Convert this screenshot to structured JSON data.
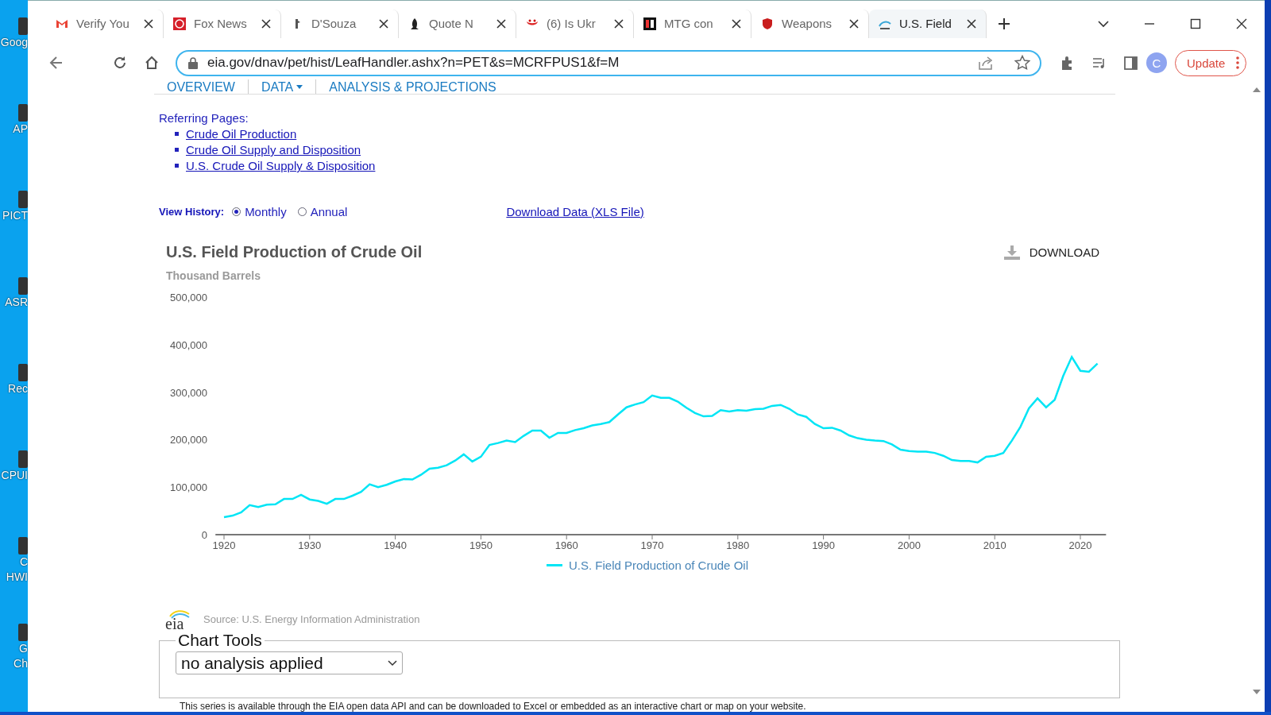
{
  "desktop_icons": [
    {
      "lines": [
        "Goog"
      ]
    },
    {
      "lines": [
        "AP"
      ]
    },
    {
      "lines": [
        "PICT"
      ]
    },
    {
      "lines": [
        "ASR"
      ]
    },
    {
      "lines": [
        "Rec"
      ]
    },
    {
      "lines": [
        "CPUI"
      ]
    },
    {
      "lines": [
        "C",
        "HWI"
      ]
    },
    {
      "lines": [
        "G",
        "Ch"
      ]
    }
  ],
  "browser": {
    "tabs": [
      {
        "title": "Verify You",
        "kind": "mail",
        "selected": false
      },
      {
        "title": "Fox News",
        "kind": "globe",
        "selected": false
      },
      {
        "title": "D'Souza",
        "kind": "figure",
        "selected": false
      },
      {
        "title": "Quote N",
        "kind": "bird",
        "selected": false
      },
      {
        "title": "(6) Is Ukr",
        "kind": "mask",
        "selected": false
      },
      {
        "title": "MTG con",
        "kind": "square",
        "selected": false
      },
      {
        "title": "Weapons",
        "kind": "shield",
        "selected": false
      },
      {
        "title": "U.S. Field",
        "kind": "arc",
        "selected": true
      }
    ],
    "address": "eia.gov/dnav/pet/hist/LeafHandler.ashx?n=PET&s=MCRFPUS1&f=M",
    "profile": "C",
    "update_button": "Update"
  },
  "page": {
    "nav_tabs": [
      {
        "label": "OVERVIEW",
        "selected": false
      },
      {
        "label": "DATA",
        "selected": true
      },
      {
        "label": "ANALYSIS & PROJECTIONS",
        "selected": false
      }
    ],
    "referring_pages": {
      "heading": "Referring Pages:",
      "links": [
        "Crude Oil Production",
        "Crude Oil Supply and Disposition",
        "U.S. Crude Oil Supply & Disposition"
      ]
    },
    "view_history": {
      "label": "View History:",
      "options": [
        {
          "label": "Monthly",
          "selected": true
        },
        {
          "label": "Annual",
          "selected": false
        }
      ]
    },
    "download_link": "Download Data (XLS File)",
    "chart": {
      "title": "U.S. Field Production of Crude Oil",
      "units": "Thousand Barrels",
      "download": "DOWNLOAD",
      "chart_data": {
        "type": "line",
        "x": [
          1920,
          1921,
          1922,
          1923,
          1924,
          1925,
          1926,
          1927,
          1928,
          1929,
          1930,
          1931,
          1932,
          1933,
          1934,
          1935,
          1936,
          1937,
          1938,
          1939,
          1940,
          1941,
          1942,
          1943,
          1944,
          1945,
          1946,
          1947,
          1948,
          1949,
          1950,
          1951,
          1952,
          1953,
          1954,
          1955,
          1956,
          1957,
          1958,
          1959,
          1960,
          1961,
          1962,
          1963,
          1964,
          1965,
          1966,
          1967,
          1968,
          1969,
          1970,
          1971,
          1972,
          1973,
          1974,
          1975,
          1976,
          1977,
          1978,
          1979,
          1980,
          1981,
          1982,
          1983,
          1984,
          1985,
          1986,
          1987,
          1988,
          1989,
          1990,
          1991,
          1992,
          1993,
          1994,
          1995,
          1996,
          1997,
          1998,
          1999,
          2000,
          2001,
          2002,
          2003,
          2004,
          2005,
          2006,
          2007,
          2008,
          2009,
          2010,
          2011,
          2012,
          2013,
          2014,
          2015,
          2016,
          2017,
          2018,
          2019,
          2020,
          2021,
          2022
        ],
        "series": [
          {
            "name": "U.S. Field Production of Crude Oil",
            "color": "#00e5f5",
            "values": [
              37000,
              40000,
              47000,
              62000,
              58000,
              63000,
              64000,
              75000,
              75000,
              84000,
              74000,
              71000,
              65000,
              75000,
              75000,
              82000,
              90000,
              106000,
              100000,
              105000,
              112000,
              117000,
              116000,
              126000,
              139000,
              141000,
              146000,
              156000,
              169000,
              154000,
              164000,
              189000,
              193000,
              198000,
              195000,
              208000,
              219000,
              219000,
              204000,
              214000,
              214000,
              220000,
              224000,
              230000,
              233000,
              237000,
              253000,
              268000,
              274000,
              279000,
              293000,
              288000,
              288000,
              280000,
              267000,
              256000,
              249000,
              250000,
              262000,
              259000,
              262000,
              261000,
              264000,
              265000,
              271000,
              273000,
              265000,
              253000,
              248000,
              233000,
              224000,
              225000,
              219000,
              209000,
              203000,
              200000,
              198000,
              197000,
              190000,
              179000,
              176000,
              175000,
              175000,
              172000,
              166000,
              157000,
              155000,
              155000,
              152000,
              164000,
              166000,
              172000,
              198000,
              227000,
              266000,
              287000,
              268000,
              284000,
              334000,
              374000,
              345000,
              343000,
              360000
            ]
          }
        ],
        "xlim": [
          1919,
          2023
        ],
        "ylim": [
          0,
          500000
        ],
        "xticks": [
          1920,
          1930,
          1940,
          1950,
          1960,
          1970,
          1980,
          1990,
          2000,
          2010,
          2020
        ],
        "yticks": [
          {
            "value": 0,
            "label": "0"
          },
          {
            "value": 100000,
            "label": "100,000"
          },
          {
            "value": 200000,
            "label": "200,000"
          },
          {
            "value": 300000,
            "label": "300,000"
          },
          {
            "value": 400000,
            "label": "400,000"
          },
          {
            "value": 500000,
            "label": "500,000"
          }
        ]
      },
      "logo_text": "eia",
      "source": "Source: U.S. Energy Information Administration"
    },
    "chart_tools": {
      "legend": "Chart Tools",
      "select_value": "no analysis applied"
    },
    "note": "This series is available through the EIA open data API and can be downloaded to Excel or embedded as an interactive chart or map on your website."
  }
}
